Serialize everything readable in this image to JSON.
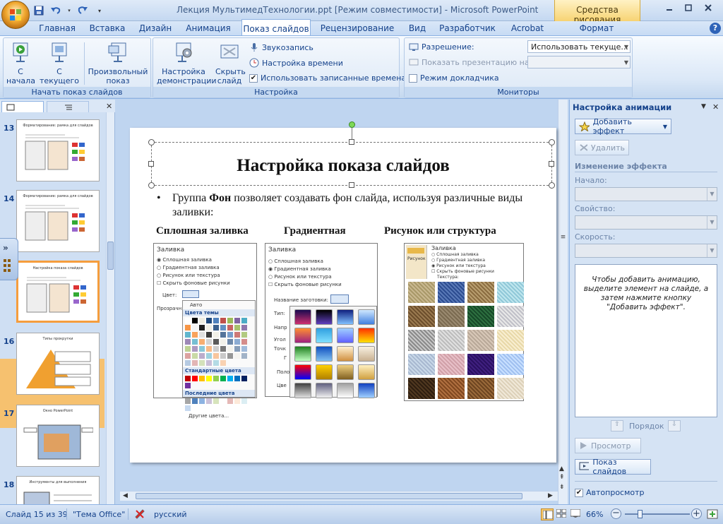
{
  "window": {
    "title": "Лекция МультимедТехнологии.ppt [Режим совместимости] - Microsoft PowerPoint",
    "context_tab": "Средства рисования"
  },
  "tabs": [
    "Главная",
    "Вставка",
    "Дизайн",
    "Анимация",
    "Показ слайдов",
    "Рецензирование",
    "Вид",
    "Разработчик",
    "Acrobat",
    "Формат"
  ],
  "active_tab": "Показ слайдов",
  "ribbon": {
    "start_group": {
      "label": "Начать показ слайдов",
      "from_start": "С начала",
      "from_current": "С текущего слайда",
      "custom": "Произвольный показ"
    },
    "setup_group": {
      "label": "Настройка",
      "setup": "Настройка демонстрации",
      "hide": "Скрыть слайд",
      "record_narration": "Звукозапись",
      "rehearse": "Настройка времени",
      "use_timings": "Использовать записанные времена",
      "use_timings_checked": true
    },
    "monitors_group": {
      "label": "Мониторы",
      "resolution_label": "Разрешение:",
      "resolution_value": "Использовать текуще...",
      "show_on_label": "Показать презентацию на:",
      "show_on_value": "",
      "presenter_view": "Режим докладчика",
      "presenter_view_checked": false
    }
  },
  "thumbnails": [
    {
      "num": "13",
      "title": "Форматирование: рамка для слайдов"
    },
    {
      "num": "14",
      "title": "Форматирование: рамка для слайдов"
    },
    {
      "num": "15",
      "title": "Настройка показа слайдов",
      "selected": true
    },
    {
      "num": "16",
      "title": "Типы прокрутки"
    },
    {
      "num": "17",
      "title": "Окно PowerPoint"
    },
    {
      "num": "18",
      "title": "Инструменты для выполнения"
    }
  ],
  "slide": {
    "title": "Настройка показа слайдов",
    "bullet_pre": "Группа ",
    "bullet_bold": "Фон",
    "bullet_post": " позволяет создавать фон слайда, используя различные виды заливки:",
    "col1": "Сплошная заливка",
    "col2": "Градиентная",
    "col3": "Рисунок или структура",
    "dlg1": {
      "title": "Заливка",
      "opt1": "Сплошная заливка",
      "opt2": "Градиентная заливка",
      "opt3": "Рисунок или текстура",
      "opt4": "Скрыть фоновые рисунки",
      "color_label": "Цвет:",
      "transp_label": "Прозрачн",
      "auto": "Авто",
      "theme_colors": "Цвета темы",
      "std_colors": "Стандартные цвета",
      "recent_colors": "Последние цвета",
      "more_colors": "Другие цвета..."
    },
    "dlg2": {
      "title": "Заливка",
      "opt1": "Сплошная заливка",
      "opt2": "Градиентная заливка",
      "opt3": "Рисунок или текстура",
      "opt4": "Скрыть фоновые рисунки",
      "preset_label": "Название заготовки:",
      "type_label": "Тип:",
      "dir_label": "Напр",
      "angle_label": "Угол",
      "points_label": "Точк",
      "pos_label": "Поло",
      "color_label": "Цве",
      "f": "Г"
    },
    "dlg3": {
      "tab": "Рисунок",
      "title": "Заливка",
      "opt1": "Сплошная заливка",
      "opt2": "Градиентная заливка",
      "opt3": "Рисунок или текстура",
      "opt4": "Скрыть фоновые рисунки",
      "texture": "Текстура:"
    }
  },
  "anim_pane": {
    "title": "Настройка анимации",
    "add_effect": "Добавить эффект",
    "remove": "Удалить",
    "change_effect": "Изменение эффекта",
    "start_label": "Начало:",
    "property_label": "Свойство:",
    "speed_label": "Скорость:",
    "info": "Чтобы добавить анимацию, выделите элемент на слайде, а затем нажмите кнопку \"Добавить эффект\".",
    "order": "Порядок",
    "preview": "Просмотр",
    "slideshow": "Показ слайдов",
    "autopreview": "Автопросмотр",
    "autopreview_checked": true
  },
  "status": {
    "slide_info": "Слайд 15 из 39",
    "theme": "\"Тема Office\"",
    "language": "русский",
    "zoom": "66%"
  },
  "colors": {
    "ribbon_bg": "#dbe8f7",
    "accent": "#15428b",
    "selection": "#f59d3d"
  },
  "icons": [
    "office-logo",
    "save-icon",
    "undo-icon",
    "redo-icon",
    "minimize-icon",
    "maximize-icon",
    "close-icon",
    "help-icon",
    "slideshow-icon",
    "star-icon",
    "play-icon"
  ]
}
